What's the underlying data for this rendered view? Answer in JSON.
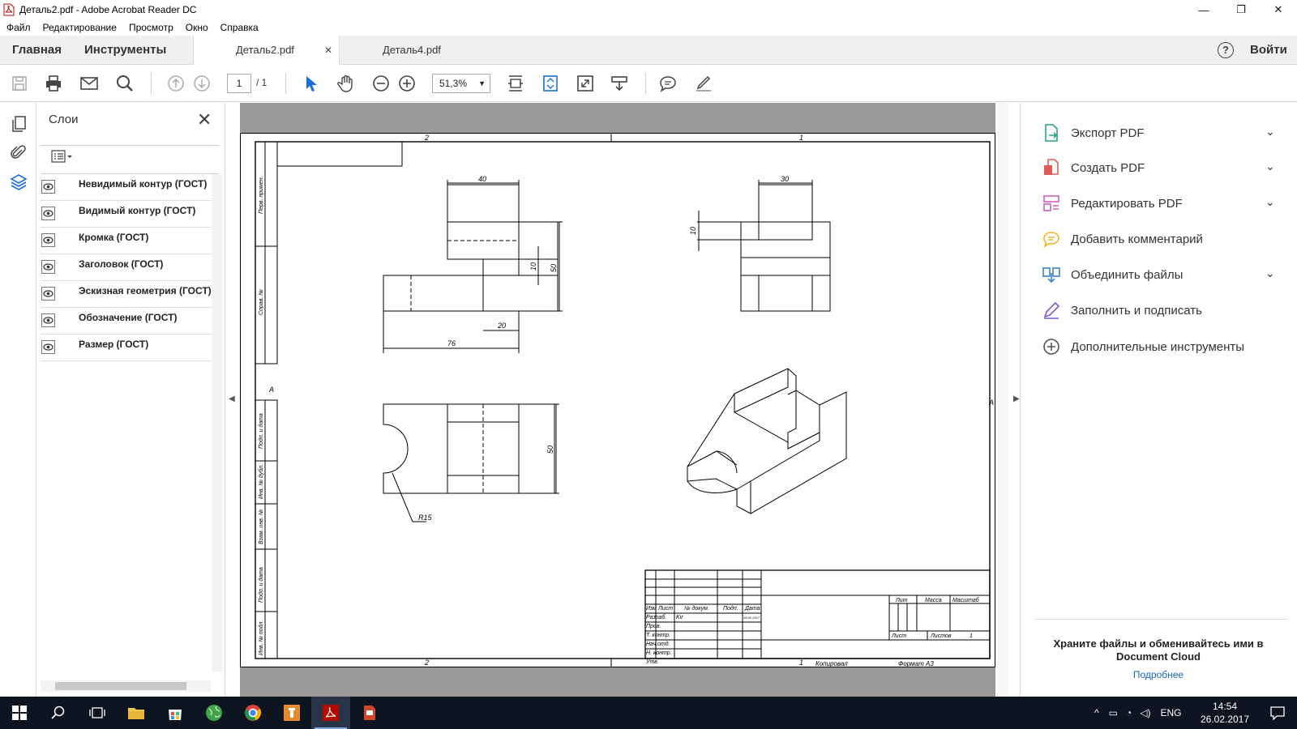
{
  "window": {
    "title": "Деталь2.pdf - Adobe Acrobat Reader DC",
    "controls": [
      "—",
      "❐",
      "✕"
    ]
  },
  "menu": [
    "Файл",
    "Редактирование",
    "Просмотр",
    "Окно",
    "Справка"
  ],
  "nav": {
    "home": "Главная",
    "tools": "Инструменты",
    "tabs": [
      {
        "label": "Деталь2.pdf",
        "close": "✕"
      },
      {
        "label": "Деталь4.pdf"
      }
    ],
    "help": "?",
    "signin": "Войти"
  },
  "toolbar": {
    "page_current": "1",
    "page_total": "/ 1",
    "zoom": "51,3%",
    "zoom_caret": "▼"
  },
  "layers_panel": {
    "title": "Слои",
    "close": "✕",
    "items": [
      "Невидимый контур (ГОСТ)",
      "Видимый контур (ГОСТ)",
      "Кромка (ГОСТ)",
      "Заголовок (ГОСТ)",
      "Эскизная геометрия (ГОСТ)",
      "Обозначение (ГОСТ)",
      "Размер (ГОСТ)"
    ]
  },
  "drawing": {
    "zone_top_left": "2",
    "zone_top_right": "1",
    "zone_bottom_left": "2",
    "zone_bottom_right": "1",
    "zone_side_left": "А",
    "zone_side_right": "А",
    "dims": {
      "front_width": "40",
      "front_height": "50",
      "front_step": "10",
      "front_small": "20",
      "front_length": "76",
      "side_width": "30",
      "side_step": "10",
      "top_height": "50",
      "radius": "R15"
    },
    "side_columns": [
      "Перв. примен.",
      "Справ. №",
      "Подп. и дата",
      "Инв. № дубл.",
      "Взам. инв. №",
      "Подп. и дата",
      "Инв. № подл."
    ],
    "title_block": {
      "headers": [
        "Изм",
        "Лист",
        "№ докум.",
        "Подп.",
        "Дата"
      ],
      "rows": [
        "Разраб.",
        "Пров.",
        "Т. контр.",
        "Нач.отд.",
        "Н. контр.",
        "Утв."
      ],
      "developer": "Kir",
      "date": "26.02.2017",
      "lit": "Лит",
      "mass": "Масса",
      "scale": "Масштаб",
      "sheet": "Лист",
      "sheets": "Листов",
      "sheets_value": "1",
      "copied": "Копировал",
      "format": "Формат А3",
      "copied_num": "1"
    }
  },
  "tools_pane": [
    {
      "label": "Экспорт PDF",
      "chevron": true
    },
    {
      "label": "Создать PDF",
      "chevron": true
    },
    {
      "label": "Редактировать PDF",
      "chevron": true
    },
    {
      "label": "Добавить комментарий",
      "chevron": false
    },
    {
      "label": "Объединить файлы",
      "chevron": true
    },
    {
      "label": "Заполнить и подписать",
      "chevron": false
    },
    {
      "label": "Дополнительные инструменты",
      "chevron": false
    }
  ],
  "promo": {
    "text": "Храните файлы и обменивайтесь ими в Document Cloud",
    "link": "Подробнее"
  },
  "taskbar": {
    "lang": "ENG",
    "time": "14:54",
    "date": "26.02.2017"
  },
  "colors": {
    "accent": "#1473e6",
    "export": "#2aa57b",
    "create": "#e05c5c",
    "edit": "#d35fb7",
    "comment": "#f0b429",
    "combine": "#3b82c4",
    "sign": "#7b5ad1",
    "taskbar": "#0e1420"
  }
}
